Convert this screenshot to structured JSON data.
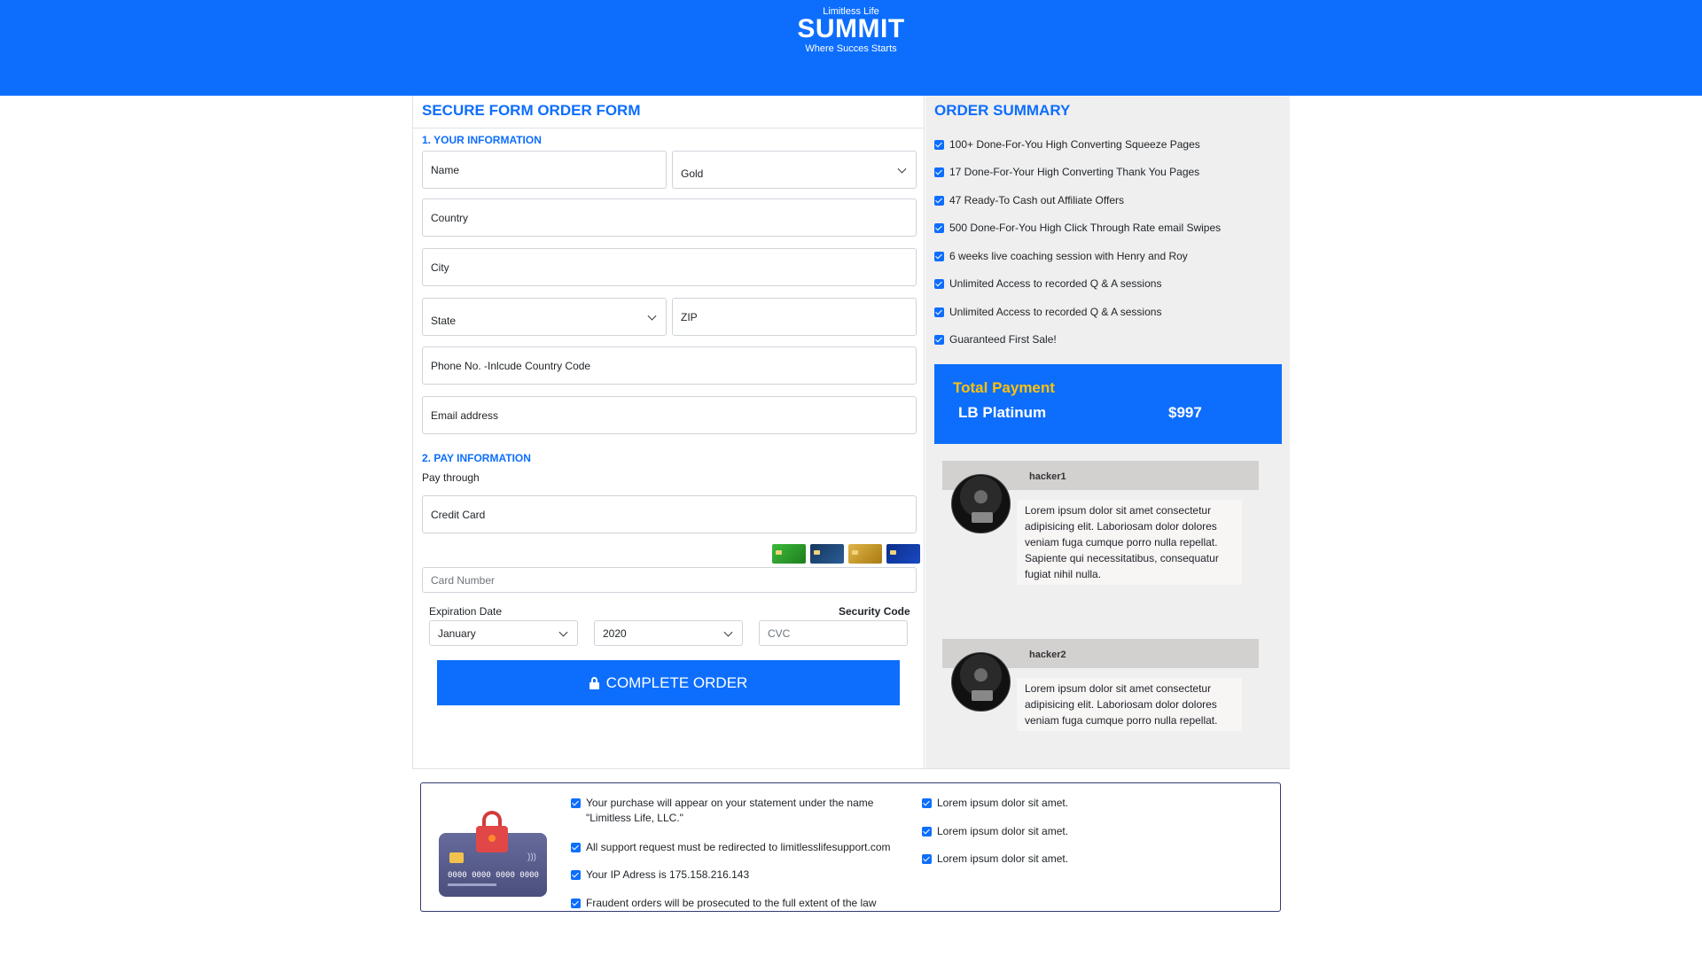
{
  "header": {
    "brand_small": "Limitless Life",
    "brand_big": "SUMMIT",
    "tagline": "Where Succes Starts"
  },
  "form": {
    "title": "SECURE FORM ORDER FORM",
    "section1": "1. YOUR INFORMATION",
    "name_placeholder": "Name",
    "package_selected": "Gold",
    "country_placeholder": "Country",
    "city_placeholder": "City",
    "state_selected": "State",
    "zip_placeholder": "ZIP",
    "phone_placeholder": "Phone No. -Inlcude Country Code",
    "email_placeholder": "Email address",
    "section2": "2. PAY INFORMATION",
    "pay_through_label": "Pay through",
    "pay_method": "Credit Card",
    "card_number_placeholder": "Card Number",
    "expiration_label": "Expiration Date",
    "security_label": "Security Code",
    "month_selected": "January",
    "year_selected": "2020",
    "cvc_placeholder": "CVC",
    "complete_button": "COMPLETE ORDER"
  },
  "summary": {
    "title": "ORDER SUMMARY",
    "items": [
      "100+ Done-For-You High Converting Squeeze Pages",
      "17 Done-For-Your High Converting Thank You Pages",
      "47 Ready-To Cash out Affiliate Offers",
      "500 Done-For-You High Click Through Rate email Swipes",
      "6 weeks live coaching session with Henry and Roy",
      "Unlimited Access to recorded Q & A sessions",
      "Unlimited Access to recorded Q & A sessions",
      "Guaranteed First Sale!"
    ],
    "total_title": "Total Payment",
    "total_plan": "LB Platinum",
    "total_price": "$997"
  },
  "testimonials": [
    {
      "name": "hacker1",
      "text": "Lorem ipsum dolor sit amet consectetur adipisicing elit. Laboriosam dolor dolores veniam fuga cumque porro nulla repellat. Sapiente qui necessitatibus, consequatur fugiat nihil nulla."
    },
    {
      "name": "hacker2",
      "text": "Lorem ipsum dolor sit amet consectetur adipisicing elit. Laboriosam dolor dolores veniam fuga cumque porro nulla repellat."
    }
  ],
  "secure_info": {
    "card_number_art": "0000 0000 0000 0000",
    "left_items": [
      "Your purchase will appear on your statement under the name \"Limitless Life, LLC.\"",
      "All support request must be redirected to limitlesslifesupport.com",
      "Your IP Adress is 175.158.216.143",
      "Fraudent orders will be prosecuted to the full extent of the law"
    ],
    "right_items": [
      "Lorem ipsum dolor sit amet.",
      "Lorem ipsum dolor sit amet.",
      "Lorem ipsum dolor sit amet."
    ]
  },
  "colors": {
    "primary": "#0d6efd",
    "accent_gold": "#ffc107",
    "summary_bg": "#efefef"
  }
}
